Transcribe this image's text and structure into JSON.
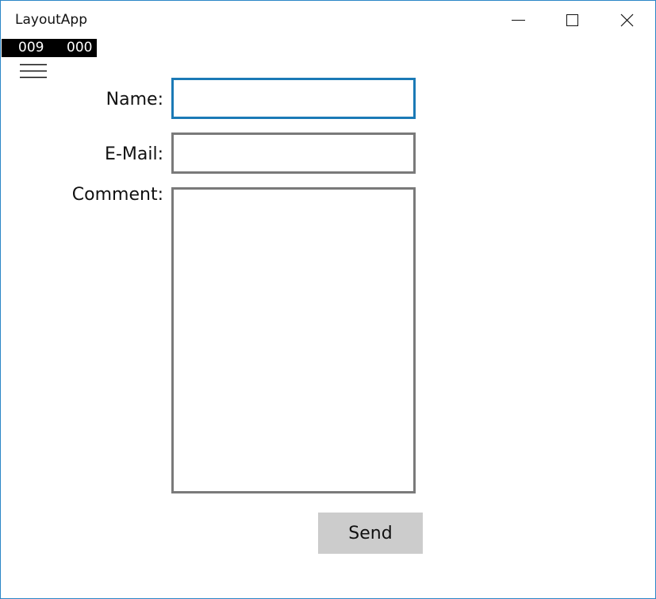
{
  "window": {
    "title": "LayoutApp",
    "accent_color": "#2b86c7",
    "controls": {
      "minimize": "minimize-icon",
      "maximize": "maximize-icon",
      "close": "close-icon"
    }
  },
  "counter": {
    "left": "009",
    "right": "000"
  },
  "nav": {
    "menu_icon": "hamburger-menu-icon"
  },
  "form": {
    "name_label": "Name:",
    "name_value": "",
    "email_label": "E-Mail:",
    "email_value": "",
    "comment_label": "Comment:",
    "comment_value": "",
    "focused_border_color": "#1b7ab6",
    "field_border_color": "#7a7a7a",
    "send_label": "Send",
    "send_bg_color": "#cccccc"
  }
}
